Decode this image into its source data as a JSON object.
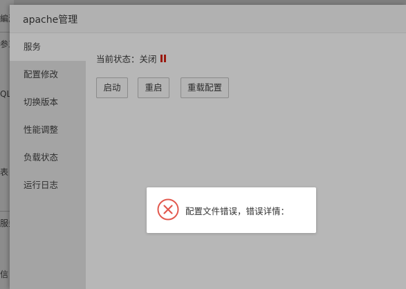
{
  "background_page": {
    "fragments": [
      "編源",
      "参工",
      "QL",
      "表",
      "服务",
      "信"
    ]
  },
  "window": {
    "title": "apache管理"
  },
  "sidebar": {
    "items": [
      {
        "label": "服务",
        "active": true
      },
      {
        "label": "配置修改",
        "active": false
      },
      {
        "label": "切换版本",
        "active": false
      },
      {
        "label": "性能调整",
        "active": false
      },
      {
        "label": "负载状态",
        "active": false
      },
      {
        "label": "运行日志",
        "active": false
      }
    ]
  },
  "content": {
    "status_label": "当前状态：关闭",
    "status_icon": "pause-icon",
    "status_color": "#9a1a0f",
    "buttons": {
      "start": "启动",
      "restart": "重启",
      "reload": "重载配置"
    }
  },
  "dialog": {
    "icon": "error-circle-icon",
    "icon_color": "#e2574c",
    "message": "配置文件错误，错误详情："
  }
}
